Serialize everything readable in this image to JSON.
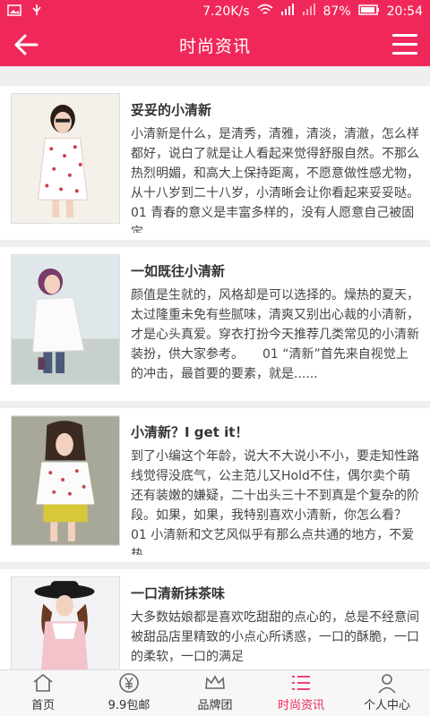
{
  "status_bar": {
    "left_icons": [
      "image-icon",
      "usb-icon"
    ],
    "net_speed": "7.20K/s",
    "battery": "87%",
    "time": "20:54"
  },
  "app_bar": {
    "title": "时尚资讯"
  },
  "articles": [
    {
      "title": "妥妥的小清新",
      "excerpt": "小清新是什么，是清秀，清雅，清淡，清澈，怎么样都好，说白了就是让人看起来觉得舒服自然。不那么热烈明媚，和高大上保持距离，不愿意做性感尤物，从十八岁到二十八岁，小清晰会让你看起来妥妥哒。　　01 青春的意义是丰富多样的，没有人愿意自己被固定......"
    },
    {
      "title": "一如既往小清新",
      "excerpt": "颜值是生就的，风格却是可以选择的。燥热的夏天，太过隆重未免有些腻味，清爽又别出心裁的小清新，才是心头真爱。穿衣打扮今天推荐几类常见的小清新装扮，供大家参考。　　01 “清新”首先来自视觉上的冲击，最首要的要素，就是......"
    },
    {
      "title": "小清新？I get it！",
      "excerpt": "到了小编这个年龄，说大不大说小不小，要走知性路线觉得没底气，公主范儿又Hold不住，偶尔卖个萌还有装嫩的嫌疑，二十出头三十不到真是个复杂的阶段。如果，如果，我特别喜欢小清新，你怎么看？　　01 小清新和文艺风似乎有那么点共通的地方，不爱热......"
    },
    {
      "title": "一口清新抹茶味",
      "excerpt": "大多数姑娘都是喜欢吃甜甜的点心的，总是不经意间被甜品店里精致的小点心所诱惑，一口的酥脆，一口的柔软，一口的满足"
    }
  ],
  "bottom_nav": [
    {
      "label": "首页",
      "icon": "home-icon",
      "active": false
    },
    {
      "label": "9.9包邮",
      "icon": "yen-icon",
      "active": false
    },
    {
      "label": "品牌团",
      "icon": "crown-icon",
      "active": false
    },
    {
      "label": "时尚资讯",
      "icon": "list-icon",
      "active": true
    },
    {
      "label": "个人中心",
      "icon": "user-icon",
      "active": false
    }
  ],
  "colors": {
    "accent": "#f0285a"
  }
}
